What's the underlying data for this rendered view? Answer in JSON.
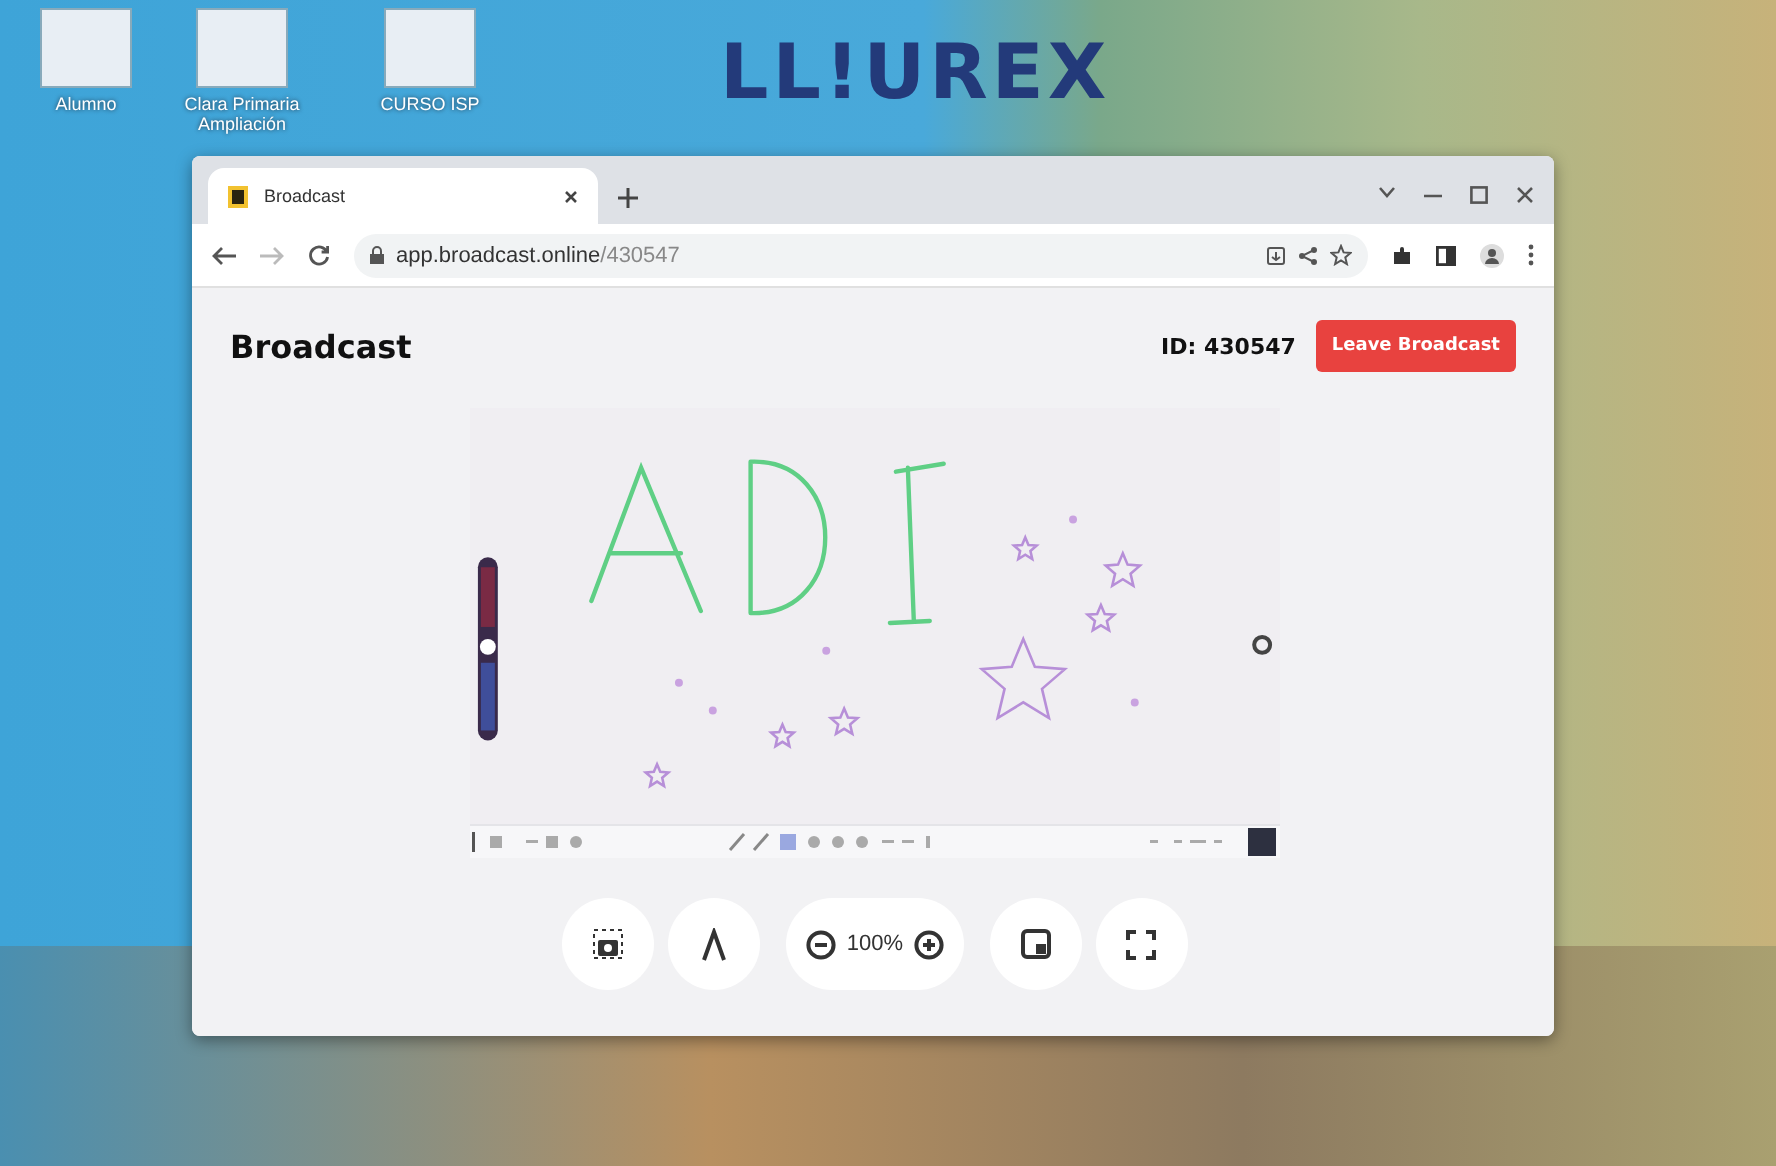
{
  "desktop": {
    "logo": "LL!UREX",
    "icons": [
      {
        "label": "Alumno"
      },
      {
        "label": "Clara Primaria Ampliación"
      },
      {
        "label": "CURSO ISP"
      }
    ]
  },
  "browser": {
    "tab": {
      "title": "Broadcast",
      "selected": true
    },
    "url_host": "app.broadcast.online",
    "url_path": "/430547"
  },
  "page": {
    "title": "Broadcast",
    "id_label": "ID: 430547",
    "leave_button": "Leave Broadcast",
    "zoom": "100%"
  }
}
